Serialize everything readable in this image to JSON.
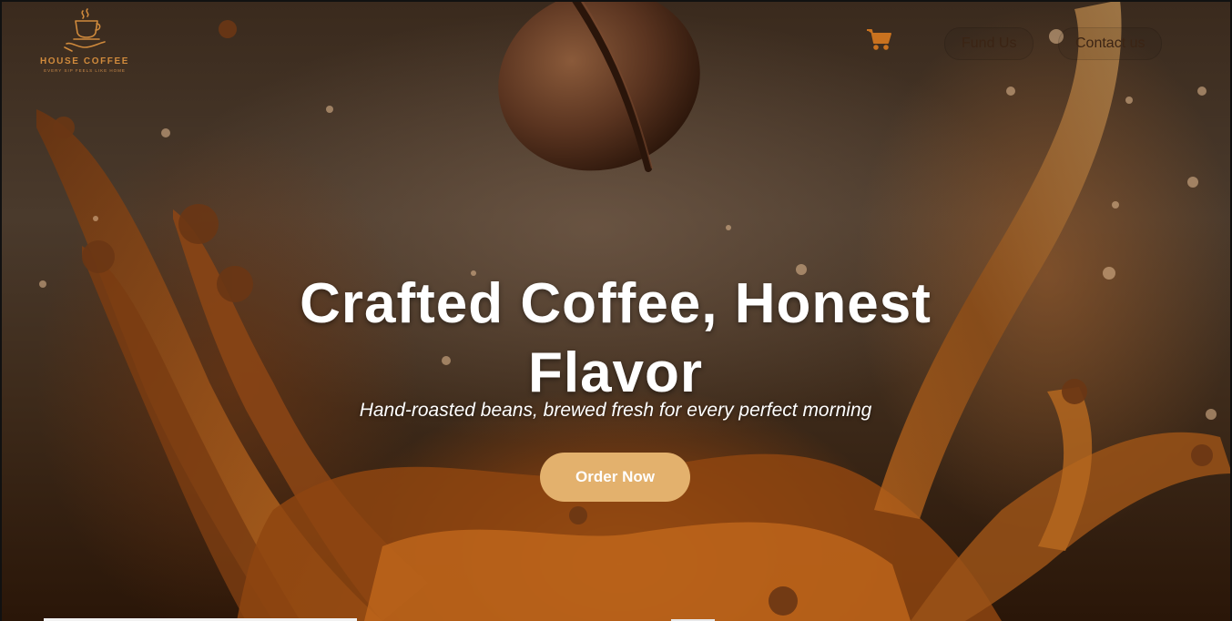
{
  "brand": {
    "name": "HOUSE COFFEE",
    "tagline": "EVERY SIP FEELS LIKE HOME",
    "accent_color": "#d08a3c"
  },
  "nav": {
    "cart_icon": "shopping-cart-icon",
    "links": [
      {
        "label": "Fund Us"
      },
      {
        "label": "Contact us"
      }
    ]
  },
  "hero": {
    "title": "Crafted Coffee, Honest Flavor",
    "subtitle": "Hand-roasted beans, brewed fresh for every perfect morning",
    "cta_label": "Order Now",
    "cta_color": "#e3b16d"
  }
}
